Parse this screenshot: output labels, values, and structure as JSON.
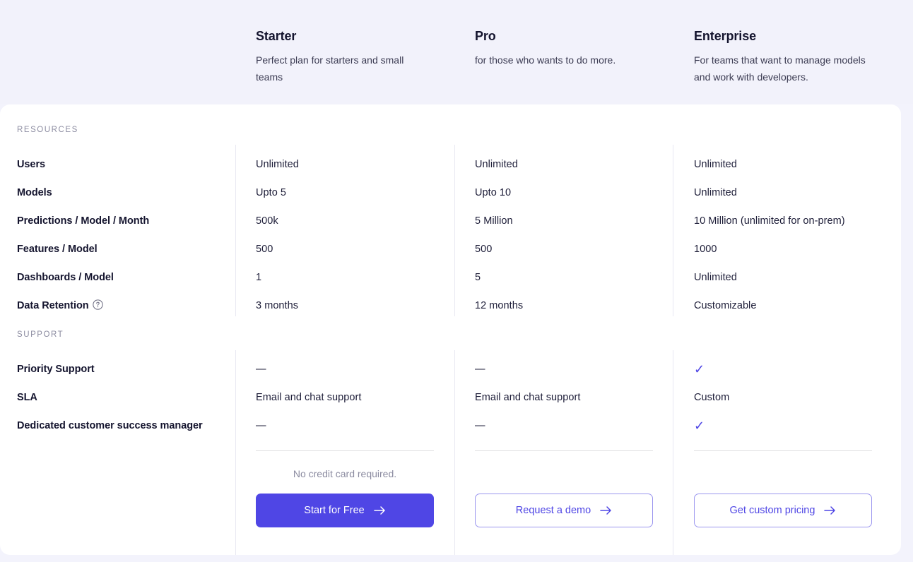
{
  "plans": [
    {
      "name": "Starter",
      "description": "Perfect plan for starters and small teams"
    },
    {
      "name": "Pro",
      "description": "for those who wants to do more."
    },
    {
      "name": "Enterprise",
      "description": "For teams that want to manage models and work with developers."
    }
  ],
  "sections": [
    {
      "label": "RESOURCES",
      "rows": [
        {
          "label": "Users",
          "has_help": false,
          "values": [
            "Unlimited",
            "Unlimited",
            "Unlimited"
          ]
        },
        {
          "label": "Models",
          "has_help": false,
          "values": [
            "Upto 5",
            "Upto 10",
            "Unlimited"
          ]
        },
        {
          "label": "Predictions / Model / Month",
          "has_help": false,
          "values": [
            "500k",
            "5 Million",
            "10 Million (unlimited for on-prem)"
          ]
        },
        {
          "label": "Features / Model",
          "has_help": false,
          "values": [
            "500",
            "500",
            "1000"
          ]
        },
        {
          "label": "Dashboards / Model",
          "has_help": false,
          "values": [
            "1",
            "5",
            "Unlimited"
          ]
        },
        {
          "label": "Data Retention",
          "has_help": true,
          "help_icon": "question-circle-icon",
          "values": [
            "3 months",
            "12 months",
            "Customizable"
          ]
        }
      ]
    },
    {
      "label": "SUPPORT",
      "rows": [
        {
          "label": "Priority Support",
          "has_help": false,
          "values": [
            "—",
            "—",
            "✓"
          ]
        },
        {
          "label": "SLA",
          "has_help": false,
          "values": [
            "Email and chat support",
            "Email and chat support",
            "Custom"
          ]
        },
        {
          "label": "Dedicated customer success manager",
          "has_help": false,
          "values": [
            "—",
            "—",
            "✓"
          ]
        }
      ]
    }
  ],
  "cta": {
    "note": "No credit card required.",
    "buttons": [
      {
        "label": "Start for Free",
        "style": "primary",
        "icon": "arrow-right-icon"
      },
      {
        "label": "Request a demo",
        "style": "outline",
        "icon": "arrow-right-icon"
      },
      {
        "label": "Get custom pricing",
        "style": "outline",
        "icon": "arrow-right-icon"
      }
    ]
  },
  "colors": {
    "accent": "#4f46e5",
    "page_background": "#f3f3fc",
    "header_background": "#f2f2fb",
    "card_background": "#ffffff",
    "text_dark": "#14142e",
    "text_muted": "#8c8ca1",
    "divider": "#e8e8f2"
  }
}
